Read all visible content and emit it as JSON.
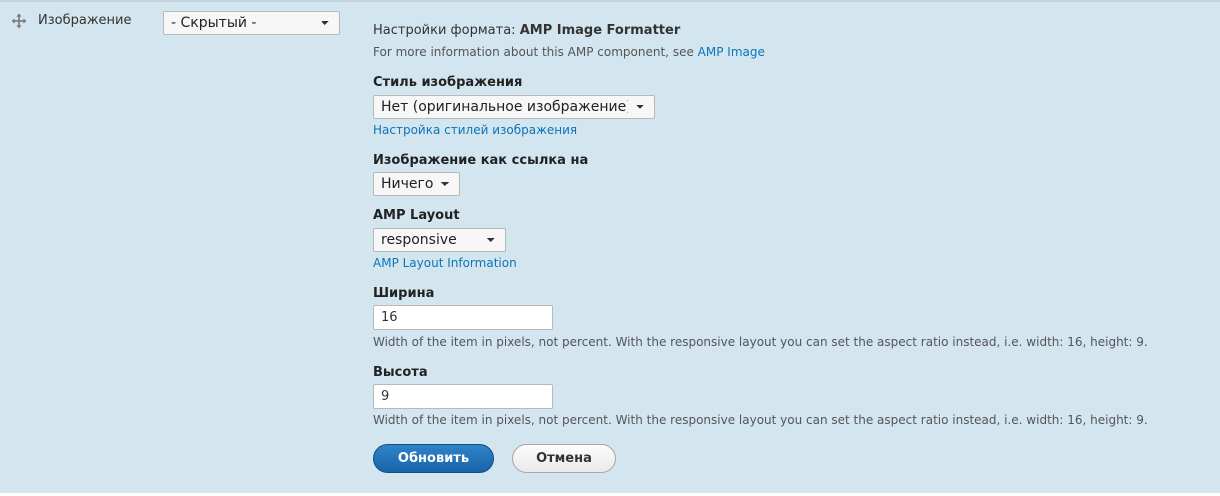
{
  "field": {
    "drag_icon": "move-arrows-icon",
    "label": "Изображение",
    "format_selected": "- Скрытый -"
  },
  "formatter": {
    "title_prefix": "Настройки формата:",
    "title_name": "AMP Image Formatter",
    "info_text": "For more information about this AMP component, see",
    "info_link": "AMP Image"
  },
  "image_style": {
    "label": "Стиль изображения",
    "selected": "Нет (оригинальное изображение)",
    "config_link": "Настройка стилей изображения"
  },
  "image_link": {
    "label": "Изображение как ссылка на",
    "selected": "Ничего"
  },
  "amp_layout": {
    "label": "AMP Layout",
    "selected": "responsive",
    "info_link": "AMP Layout Information"
  },
  "width": {
    "label": "Ширина",
    "value": "16",
    "description": "Width of the item in pixels, not percent. With the responsive layout you can set the aspect ratio instead, i.e. width: 16, height: 9."
  },
  "height": {
    "label": "Высота",
    "value": "9",
    "description": "Width of the item in pixels, not percent. With the responsive layout you can set the aspect ratio instead, i.e. width: 16, height: 9."
  },
  "actions": {
    "update_label": "Обновить",
    "cancel_label": "Отмена"
  },
  "colors": {
    "background": "#d3e6f0",
    "link": "#0b75b8",
    "primary_button": "#1f6fb5"
  }
}
